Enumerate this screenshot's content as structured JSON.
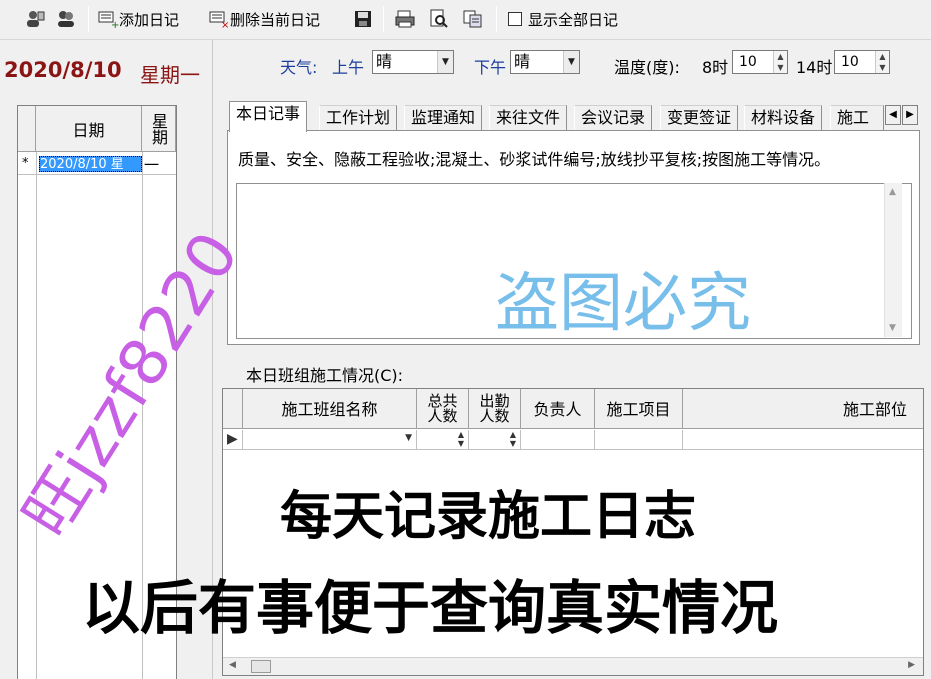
{
  "toolbar": {
    "add_label": "添加日记",
    "delete_label": "删除当前日记",
    "show_all_label": "显示全部日记",
    "show_all_checked": false
  },
  "left": {
    "date_big": "2020/8/10",
    "week_big": "星期一",
    "grid_headers": {
      "date": "日期",
      "week": "星期"
    },
    "rows": [
      {
        "marker": "*",
        "date": "2020/8/10 星",
        "week": "一"
      }
    ]
  },
  "weather": {
    "label": "天气:",
    "morning_label": "上午",
    "morning_value": "晴",
    "afternoon_label": "下午",
    "afternoon_value": "晴",
    "temp_label": "温度(度):",
    "t8_label": "8时",
    "t8_value": "10",
    "t14_label": "14时",
    "t14_value": "10"
  },
  "tabs": [
    "本日记事",
    "工作计划",
    "监理通知",
    "来往文件",
    "会议记录",
    "变更签证",
    "材料设备",
    "施工"
  ],
  "active_tab": "本日记事",
  "panel": {
    "hint": "质量、安全、隐蔽工程验收;混凝土、砂浆试件编号;放线抄平复核;按图施工等情况。",
    "memo_text": ""
  },
  "team": {
    "label": "本日班组施工情况(C):",
    "headers": [
      "施工班组名称",
      "总共人数",
      "出勤人数",
      "负责人",
      "施工项目",
      "施工部位"
    ]
  },
  "overlay": {
    "watermark_cn": "盗图必究",
    "watermark_shop": "旺jzzf8220",
    "promo_line1": "每天记录施工日志",
    "promo_line2": "以后有事便于查询真实情况"
  },
  "colors": {
    "date_red": "#8b1515",
    "label_blue": "#1c3f9c",
    "selection_blue": "#3399ff",
    "watermark_blue": "#69b8e8",
    "watermark_purple": "#c860e6"
  }
}
